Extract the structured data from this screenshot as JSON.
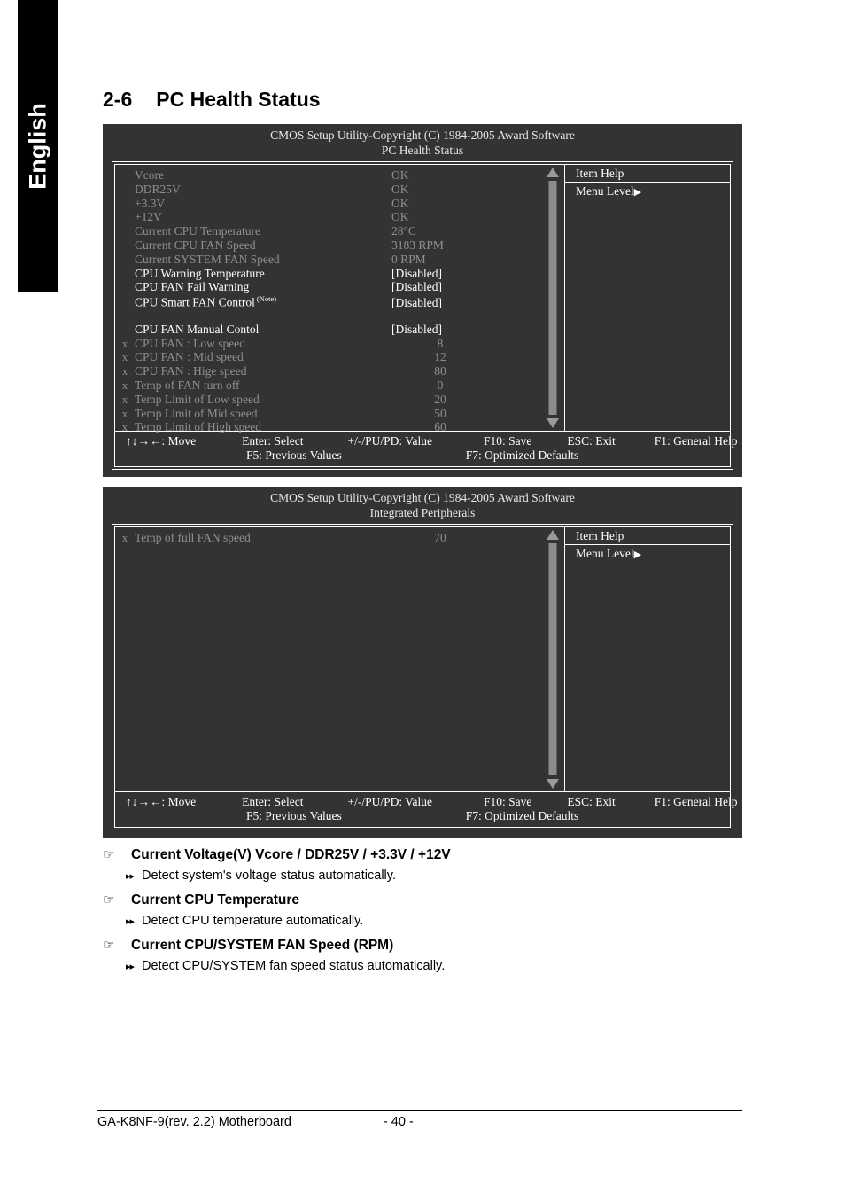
{
  "language_tab": {
    "label": "English"
  },
  "section": {
    "number": "2-6",
    "title": "PC Health Status"
  },
  "bios_screens": [
    {
      "title_line1": "CMOS Setup Utility-Copyright (C) 1984-2005 Award Software",
      "title_line2": "PC Health Status",
      "rows": [
        {
          "mark": "",
          "label": "Vcore",
          "value": "OK",
          "active": false
        },
        {
          "mark": "",
          "label": "DDR25V",
          "value": "OK",
          "active": false
        },
        {
          "mark": "",
          "label": "+3.3V",
          "value": "OK",
          "active": false
        },
        {
          "mark": "",
          "label": "+12V",
          "value": "OK",
          "active": false
        },
        {
          "mark": "",
          "label": "Current CPU Temperature",
          "value": "28°C",
          "active": false
        },
        {
          "mark": "",
          "label": "Current CPU FAN Speed",
          "value": "3183 RPM",
          "active": false
        },
        {
          "mark": "",
          "label": "Current SYSTEM FAN Speed",
          "value": "0     RPM",
          "active": false
        },
        {
          "mark": "",
          "label": "CPU Warning Temperature",
          "value": "[Disabled]",
          "active": true
        },
        {
          "mark": "",
          "label": "CPU FAN Fail Warning",
          "value": "[Disabled]",
          "active": true
        },
        {
          "mark": "",
          "label": "CPU Smart FAN Control",
          "sup": "(Note)",
          "value": "[Disabled]",
          "active": true
        },
        {
          "spacer": true
        },
        {
          "mark": "",
          "label": "CPU FAN Manual Contol",
          "value": "[Disabled]",
          "active": true
        },
        {
          "mark": "x",
          "label": "CPU FAN : Low speed",
          "value": "8",
          "centered": true,
          "active": false
        },
        {
          "mark": "x",
          "label": "CPU FAN : Mid speed",
          "value": "12",
          "centered": true,
          "active": false
        },
        {
          "mark": "x",
          "label": "CPU FAN : Hige speed",
          "value": "80",
          "centered": true,
          "active": false
        },
        {
          "mark": "x",
          "label": "Temp of FAN turn off",
          "value": "0",
          "centered": true,
          "active": false
        },
        {
          "mark": "x",
          "label": "Temp Limit of Low speed",
          "value": "20",
          "centered": true,
          "active": false
        },
        {
          "mark": "x",
          "label": "Temp Limit of Mid speed",
          "value": "50",
          "centered": true,
          "active": false
        },
        {
          "mark": "x",
          "label": "Temp Limit of High speed",
          "value": "60",
          "centered": true,
          "active": false
        }
      ],
      "help": {
        "title": "Item Help",
        "level": "Menu Level",
        "level_arrow": "▶"
      }
    },
    {
      "title_line1": "CMOS Setup Utility-Copyright (C) 1984-2005 Award Software",
      "title_line2": "Integrated Peripherals",
      "rows": [
        {
          "mark": "x",
          "label": "Temp of full FAN speed",
          "value": "70",
          "centered": true,
          "active": false
        }
      ],
      "help": {
        "title": "Item Help",
        "level": "Menu Level",
        "level_arrow": "▶"
      }
    }
  ],
  "legend": {
    "move": "↑↓→←: Move",
    "select": "Enter: Select",
    "value": "+/-/PU/PD: Value",
    "save": "F10: Save",
    "exit": "ESC: Exit",
    "help": "F1: General Help",
    "previous": "F5: Previous Values",
    "defaults": "F7: Optimized Defaults"
  },
  "bullets": [
    {
      "icon": "☞",
      "heading": "Current Voltage(V) Vcore / DDR25V / +3.3V / +12V",
      "sub_icon": "▸▸",
      "sub": "Detect system's voltage status automatically."
    },
    {
      "icon": "☞",
      "heading": "Current CPU Temperature",
      "sub_icon": "▸▸",
      "sub": "Detect CPU temperature automatically."
    },
    {
      "icon": "☞",
      "heading": "Current CPU/SYSTEM FAN Speed (RPM)",
      "sub_icon": "▸▸",
      "sub": "Detect CPU/SYSTEM fan speed status automatically."
    }
  ],
  "page_footer": {
    "product": "GA-K8NF-9(rev. 2.2) Motherboard",
    "page_number": "- 40 -"
  }
}
